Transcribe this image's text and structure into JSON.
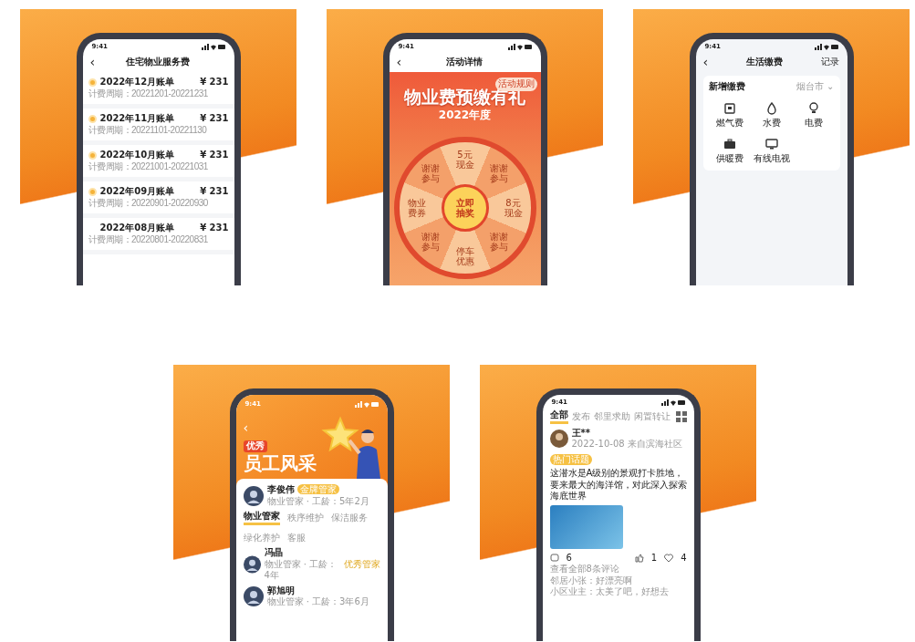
{
  "screens": [
    {
      "kind": "bills",
      "time": "9:41",
      "title": "住宅物业服务费",
      "back": "‹",
      "bills": [
        {
          "name": "2022年12月账单",
          "amount": "¥ 231",
          "period": "计费周期：20221201-20221231",
          "pending": true
        },
        {
          "name": "2022年11月账单",
          "amount": "¥ 231",
          "period": "计费周期：20221101-20221130",
          "pending": true
        },
        {
          "name": "2022年10月账单",
          "amount": "¥ 231",
          "period": "计费周期：20221001-20221031",
          "pending": true
        },
        {
          "name": "2022年09月账单",
          "amount": "¥ 231",
          "period": "计费周期：20220901-20220930",
          "pending": true
        },
        {
          "name": "2022年08月账单",
          "amount": "¥ 231",
          "period": "计费周期：20220801-20220831",
          "pending": false
        }
      ]
    },
    {
      "kind": "lottery",
      "time": "9:41",
      "title": "活动详情",
      "back": "‹",
      "rules": "活动规则",
      "headline": "物业费预缴有礼",
      "year": "2022年度",
      "prizes": [
        "5元现金",
        "谢谢参与",
        "8元现金",
        "谢谢参与",
        "停车优惠",
        "谢谢参与",
        "物业费券",
        "谢谢参与"
      ],
      "spin": "立即抽奖"
    },
    {
      "kind": "utilities",
      "time": "9:41",
      "title": "生活缴费",
      "back": "‹",
      "action": "记录",
      "section": "新增缴费",
      "city": "烟台市 ⌄",
      "items": [
        {
          "label": "燃气费",
          "kind": "gas"
        },
        {
          "label": "水费",
          "kind": "water"
        },
        {
          "label": "电费",
          "kind": "power"
        },
        {
          "label": "供暖费",
          "kind": "heat"
        },
        {
          "label": "有线电视",
          "kind": "tv"
        }
      ]
    },
    {
      "kind": "staff",
      "time": "9:41",
      "back": "‹",
      "tag": "优秀",
      "headline": "员工风采",
      "featured": {
        "name": "李俊伟",
        "badge": "金牌管家",
        "info": "物业管家 · 工龄：5年2月"
      },
      "tabs": [
        {
          "label": "物业管家",
          "selected": true
        },
        {
          "label": "秩序维护",
          "selected": false
        },
        {
          "label": "保洁服务",
          "selected": false
        },
        {
          "label": "绿化养护",
          "selected": false
        },
        {
          "label": "客服",
          "selected": false
        }
      ],
      "people": [
        {
          "name": "冯晶",
          "info": "物业管家 · 工龄：4年",
          "note": "优秀管家"
        },
        {
          "name": "郭旭明",
          "info": "物业管家 · 工龄：3年6月"
        }
      ]
    },
    {
      "kind": "feed",
      "time": "9:41",
      "tabs": [
        {
          "label": "全部",
          "selected": true
        },
        {
          "label": "发布",
          "selected": false
        },
        {
          "label": "邻里求助",
          "selected": false
        },
        {
          "label": "闲置转让",
          "selected": false
        }
      ],
      "post": {
        "name": "王**",
        "meta": "2022-10-08 来自滨海社区",
        "topic": "热门话题",
        "text": "这潜水是A级别的景观打卡胜地，要来最大的海洋馆，对此深入探索海底世界",
        "comments_count": "6",
        "likes": "1",
        "favs": "4",
        "comments": [
          "查看全部8条评论",
          "邻居小张：好漂亮啊",
          "小区业主：太美了吧，好想去"
        ]
      }
    }
  ]
}
